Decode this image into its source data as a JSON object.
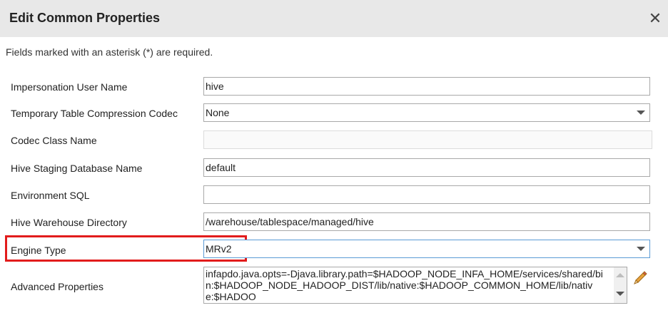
{
  "dialog": {
    "title": "Edit Common Properties",
    "close_icon": "close-icon",
    "hint": "Fields marked with an asterisk (*) are required."
  },
  "fields": {
    "impersonation_user": {
      "label": "Impersonation User Name",
      "value": "hive"
    },
    "compression_codec": {
      "label": "Temporary Table Compression Codec",
      "value": "None"
    },
    "codec_class": {
      "label": "Codec Class Name",
      "value": ""
    },
    "staging_db": {
      "label": "Hive Staging Database Name",
      "value": "default"
    },
    "environment_sql": {
      "label": "Environment SQL",
      "value": ""
    },
    "warehouse_dir": {
      "label": "Hive Warehouse Directory",
      "value": "/warehouse/tablespace/managed/hive"
    },
    "engine_type": {
      "label": "Engine Type",
      "value": "MRv2"
    },
    "advanced_properties": {
      "label": "Advanced Properties",
      "value": "infapdo.java.opts=-Djava.library.path=$HADOOP_NODE_INFA_HOME/services/shared/bin:$HADOOP_NODE_HADOOP_DIST/lib/native:$HADOOP_COMMON_HOME/lib/native:$HADOO"
    }
  },
  "icons": {
    "edit": "pencil-icon",
    "dropdown": "chevron-down-icon"
  },
  "colors": {
    "highlight": "#e21c1c",
    "focus_border": "#5b9bd5",
    "header_bg": "#e8e8e8"
  }
}
